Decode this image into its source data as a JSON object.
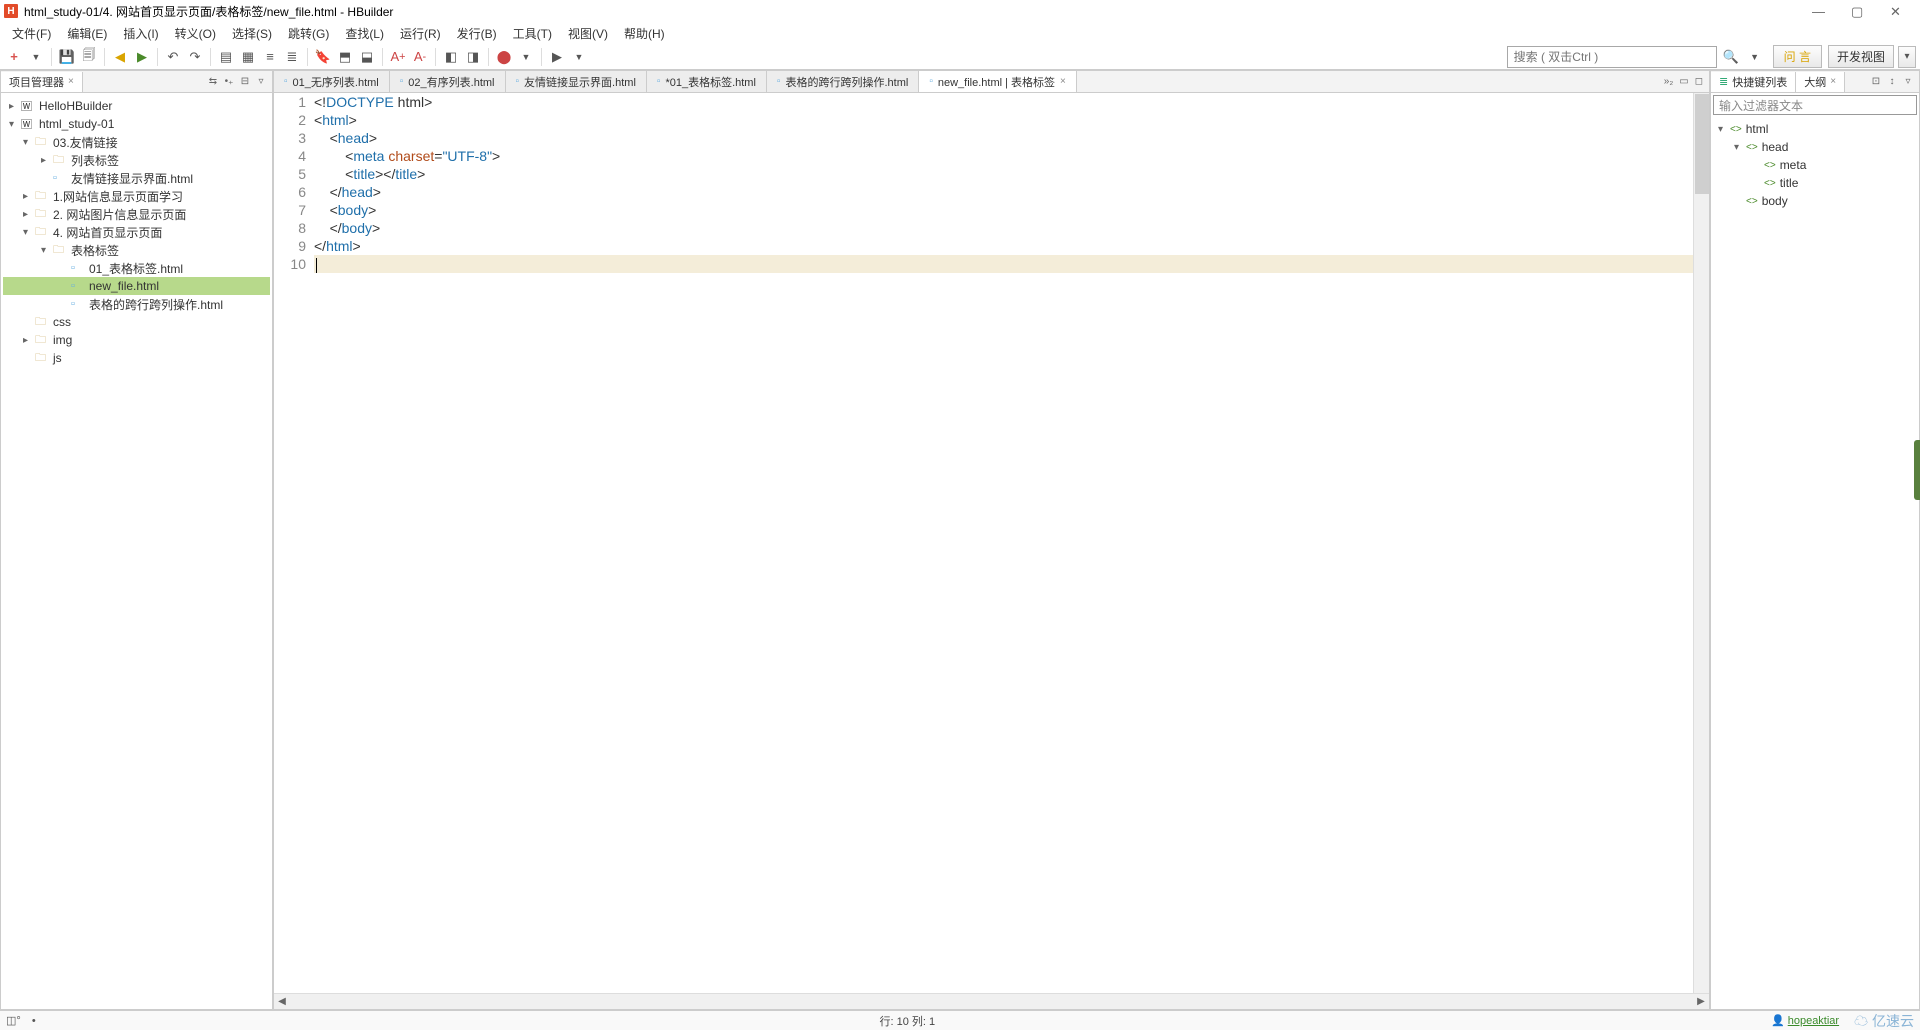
{
  "window": {
    "title": "html_study-01/4. 网站首页显示页面/表格标签/new_file.html  -  HBuilder"
  },
  "menu": [
    "文件(F)",
    "编辑(E)",
    "插入(I)",
    "转义(O)",
    "选择(S)",
    "跳转(G)",
    "查找(L)",
    "运行(R)",
    "发行(B)",
    "工具(T)",
    "视图(V)",
    "帮助(H)"
  ],
  "toolbar": {
    "search_placeholder": "搜索 ( 双击Ctrl )",
    "wy_label": "问 言",
    "dev_view_label": "开发视图"
  },
  "project_panel": {
    "title": "项目管理器",
    "items": [
      {
        "depth": 0,
        "chev": ">",
        "icon": "W",
        "label": "HelloHBuilder"
      },
      {
        "depth": 0,
        "chev": "v",
        "icon": "W",
        "label": "html_study-01"
      },
      {
        "depth": 1,
        "chev": "v",
        "icon": "📁",
        "label": "03.友情链接"
      },
      {
        "depth": 2,
        "chev": ">",
        "icon": "📁",
        "label": "列表标签"
      },
      {
        "depth": 2,
        "chev": "",
        "icon": "◫",
        "label": "友情链接显示界面.html"
      },
      {
        "depth": 1,
        "chev": ">",
        "icon": "📁",
        "label": "1.网站信息显示页面学习"
      },
      {
        "depth": 1,
        "chev": ">",
        "icon": "📁",
        "label": "2. 网站图片信息显示页面"
      },
      {
        "depth": 1,
        "chev": "v",
        "icon": "📁",
        "label": "4. 网站首页显示页面"
      },
      {
        "depth": 2,
        "chev": "v",
        "icon": "📁",
        "label": "表格标签"
      },
      {
        "depth": 3,
        "chev": "",
        "icon": "◫",
        "label": "01_表格标签.html"
      },
      {
        "depth": 3,
        "chev": "",
        "icon": "◫",
        "label": "new_file.html",
        "selected": true
      },
      {
        "depth": 3,
        "chev": "",
        "icon": "◫",
        "label": "表格的跨行跨列操作.html"
      },
      {
        "depth": 1,
        "chev": "",
        "icon": "📁",
        "label": "css"
      },
      {
        "depth": 1,
        "chev": ">",
        "icon": "📁",
        "label": "img"
      },
      {
        "depth": 1,
        "chev": "",
        "icon": "📁",
        "label": "js"
      }
    ]
  },
  "editor_tabs": [
    {
      "label": "01_无序列表.html"
    },
    {
      "label": "02_有序列表.html"
    },
    {
      "label": "友情链接显示界面.html"
    },
    {
      "label": "*01_表格标签.html"
    },
    {
      "label": "表格的跨行跨列操作.html"
    },
    {
      "label": "new_file.html | 表格标签",
      "active": true
    }
  ],
  "editor_overflow": "»₂",
  "code": {
    "lines": [
      {
        "n": "1",
        "fold": "",
        "html": "<span class='punct'>&lt;!</span><span class='doc'>DOCTYPE</span> <span class='punct'>html&gt;</span>"
      },
      {
        "n": "2",
        "fold": "⊟",
        "html": "<span class='punct'>&lt;</span><span class='tag'>html</span><span class='punct'>&gt;</span>"
      },
      {
        "n": "3",
        "fold": "⊟",
        "html": "    <span class='punct'>&lt;</span><span class='tag'>head</span><span class='punct'>&gt;</span>"
      },
      {
        "n": "4",
        "fold": "",
        "html": "        <span class='punct'>&lt;</span><span class='tag'>meta</span> <span class='attr'>charset</span><span class='punct'>=</span><span class='str'>\"UTF-8\"</span><span class='punct'>&gt;</span>"
      },
      {
        "n": "5",
        "fold": "",
        "html": "        <span class='punct'>&lt;</span><span class='tag'>title</span><span class='punct'>&gt;&lt;/</span><span class='tag'>title</span><span class='punct'>&gt;</span>"
      },
      {
        "n": "6",
        "fold": "",
        "html": "    <span class='punct'>&lt;/</span><span class='tag'>head</span><span class='punct'>&gt;</span>"
      },
      {
        "n": "7",
        "fold": "⊟",
        "html": "    <span class='punct'>&lt;</span><span class='tag'>body</span><span class='punct'>&gt;</span>"
      },
      {
        "n": "8",
        "fold": "",
        "html": "    <span class='punct'>&lt;/</span><span class='tag'>body</span><span class='punct'>&gt;</span>"
      },
      {
        "n": "9",
        "fold": "",
        "html": "<span class='punct'>&lt;/</span><span class='tag'>html</span><span class='punct'>&gt;</span>"
      },
      {
        "n": "10",
        "fold": "",
        "html": "<span class='cursor-bar'></span>",
        "current": true
      }
    ]
  },
  "outline_panel": {
    "tabs": [
      "快捷键列表",
      "大纲"
    ],
    "filter_placeholder": "输入过滤器文本",
    "items": [
      {
        "depth": 0,
        "chev": "v",
        "label": "html"
      },
      {
        "depth": 1,
        "chev": "v",
        "label": "head"
      },
      {
        "depth": 2,
        "chev": "",
        "label": "meta"
      },
      {
        "depth": 2,
        "chev": "",
        "label": "title"
      },
      {
        "depth": 1,
        "chev": "",
        "label": "body"
      }
    ]
  },
  "statusbar": {
    "cursor": "行: 10 列: 1",
    "user": "hopeaktiar",
    "cloud": "亿速云"
  }
}
